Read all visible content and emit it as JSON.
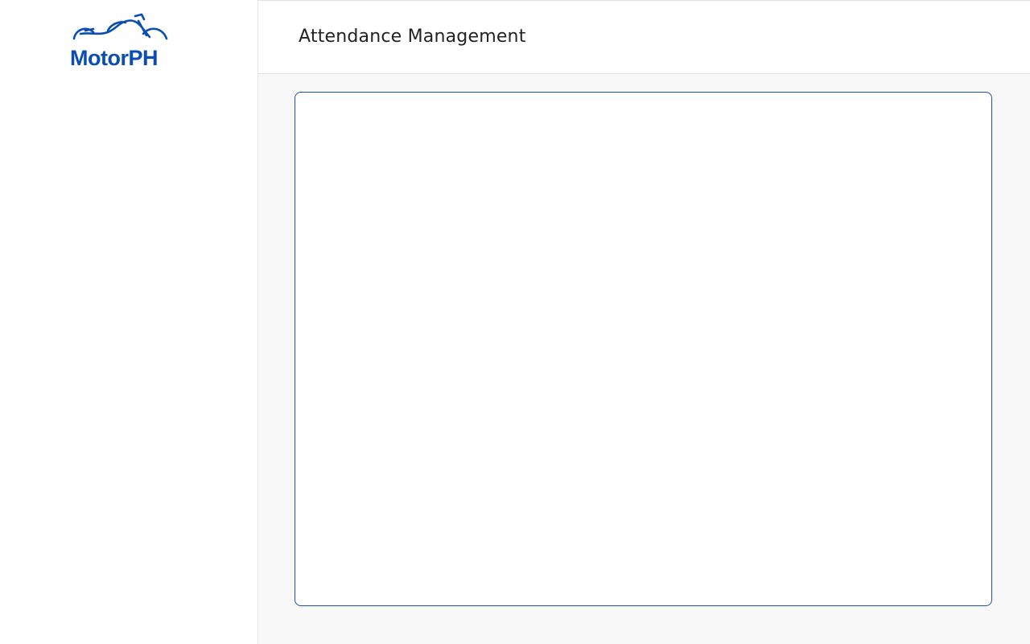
{
  "brand": {
    "name": "MotorPH",
    "logo_icon": "motorcycle-icon",
    "color": "#0b4db2"
  },
  "header": {
    "title": "Attendance Management"
  },
  "colors": {
    "panel_border": "#1f4fa3",
    "main_background": "#f8f8f8",
    "divider": "#e3e3e3",
    "title_text": "#222222"
  }
}
